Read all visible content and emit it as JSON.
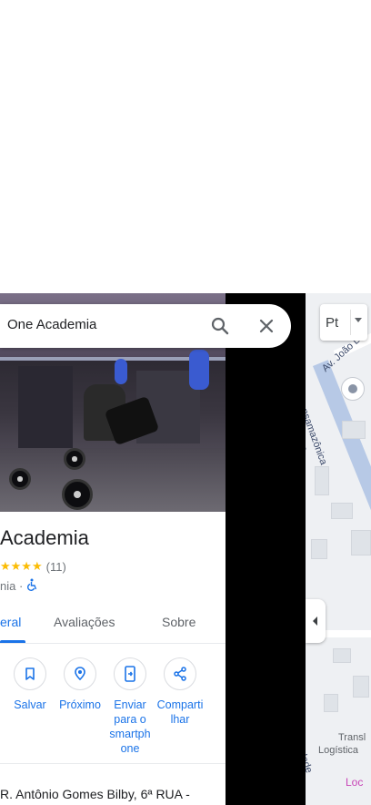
{
  "search": {
    "query": "One Academia"
  },
  "place": {
    "title": "Academia",
    "rating_count": "(11)",
    "stars": "★★★★",
    "category": "nia ·",
    "accessibility_icon": "wheelchair-icon"
  },
  "tabs": [
    {
      "label": "eral",
      "active": true
    },
    {
      "label": "Avaliações",
      "active": false
    },
    {
      "label": "Sobre",
      "active": false
    }
  ],
  "actions": [
    {
      "label": "Salvar",
      "icon": "bookmark-icon"
    },
    {
      "label": "Próximo",
      "icon": "nearby-icon"
    },
    {
      "label": "Enviar para o smartph one",
      "icon": "send-to-phone-icon"
    },
    {
      "label": "Comparti lhar",
      "icon": "share-icon"
    }
  ],
  "address": "R. Antônio Gomes Bilby, 6ª RUA -",
  "map": {
    "layer_label": "Pt",
    "street_1": "Av. João L",
    "street_2": "Transamazônica",
    "street_3": "ira",
    "street_4": "rdade",
    "poi_1": "Transl",
    "poi_2": "Logística",
    "poi_3": "Loc"
  },
  "colors": {
    "accent": "#1a73e8",
    "star": "#fbbc04"
  }
}
